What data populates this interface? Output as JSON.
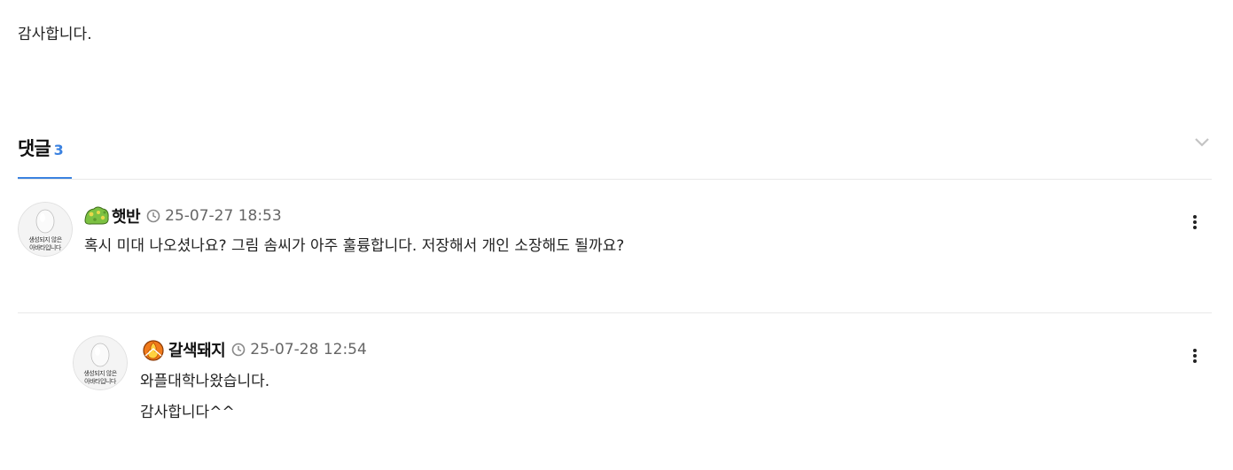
{
  "post": {
    "body_text": "감사합니다."
  },
  "comments_section": {
    "title": "댓글",
    "count": "3",
    "accent_color": "#3b82e0"
  },
  "comments": [
    {
      "avatar_text_line1": "생성되지 않은",
      "avatar_text_line2": "아바타입니다",
      "level_icon": "green-level-badge-icon",
      "nickname": "햇반",
      "date": "25-07-27 18:53",
      "lines": [
        "혹시 미대 나오셨나요? 그림 솜씨가 아주 훌륭합니다. 저장해서 개인 소장해도 될까요?"
      ]
    },
    {
      "avatar_text_line1": "생성되지 않은",
      "avatar_text_line2": "아바타입니다",
      "level_icon": "orange-flame-level-badge-icon",
      "nickname": "갈색돼지",
      "date": "25-07-28 12:54",
      "lines": [
        "와플대학나왔습니다.",
        "감사합니다^^"
      ]
    }
  ]
}
